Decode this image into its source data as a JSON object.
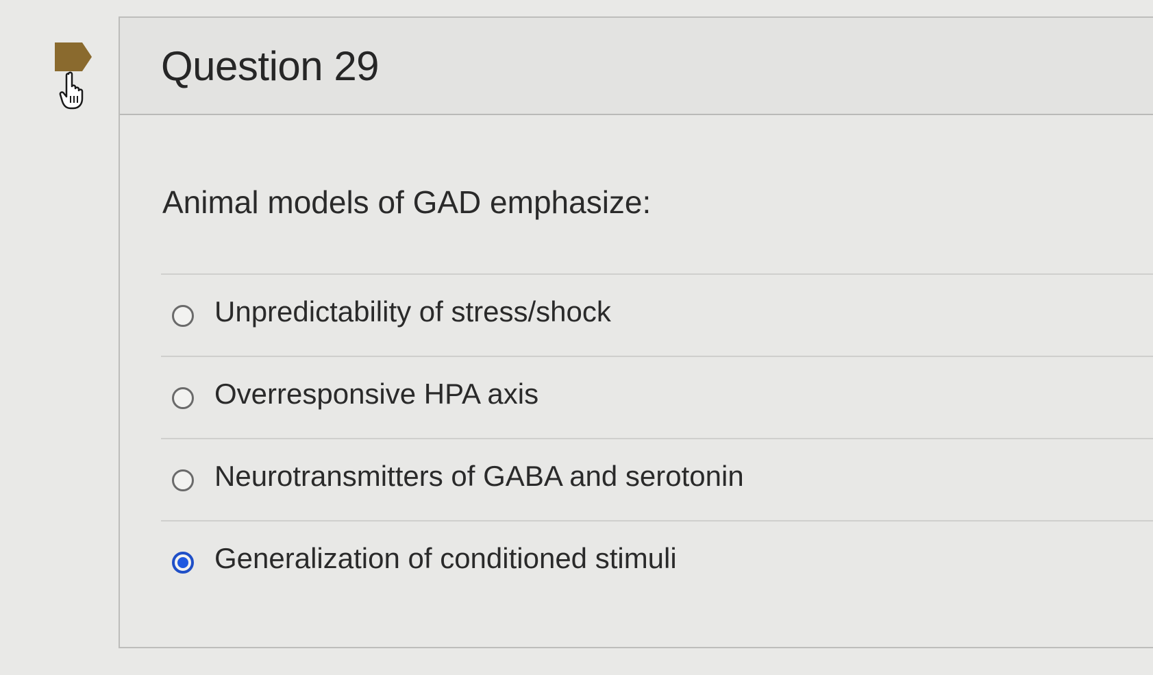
{
  "question": {
    "title": "Question 29",
    "prompt": "Animal models of GAD emphasize:"
  },
  "answers": [
    {
      "label": "Unpredictability of stress/shock",
      "selected": false
    },
    {
      "label": "Overresponsive HPA axis",
      "selected": false
    },
    {
      "label": "Neurotransmitters of GABA and serotonin",
      "selected": false
    },
    {
      "label": "Generalization of conditioned stimuli",
      "selected": true
    }
  ],
  "icons": {
    "flag": "flag-icon",
    "cursor": "hand-pointer-icon"
  },
  "colors": {
    "flag": "#8a6a2e",
    "selected_radio": "#1f58e0"
  }
}
